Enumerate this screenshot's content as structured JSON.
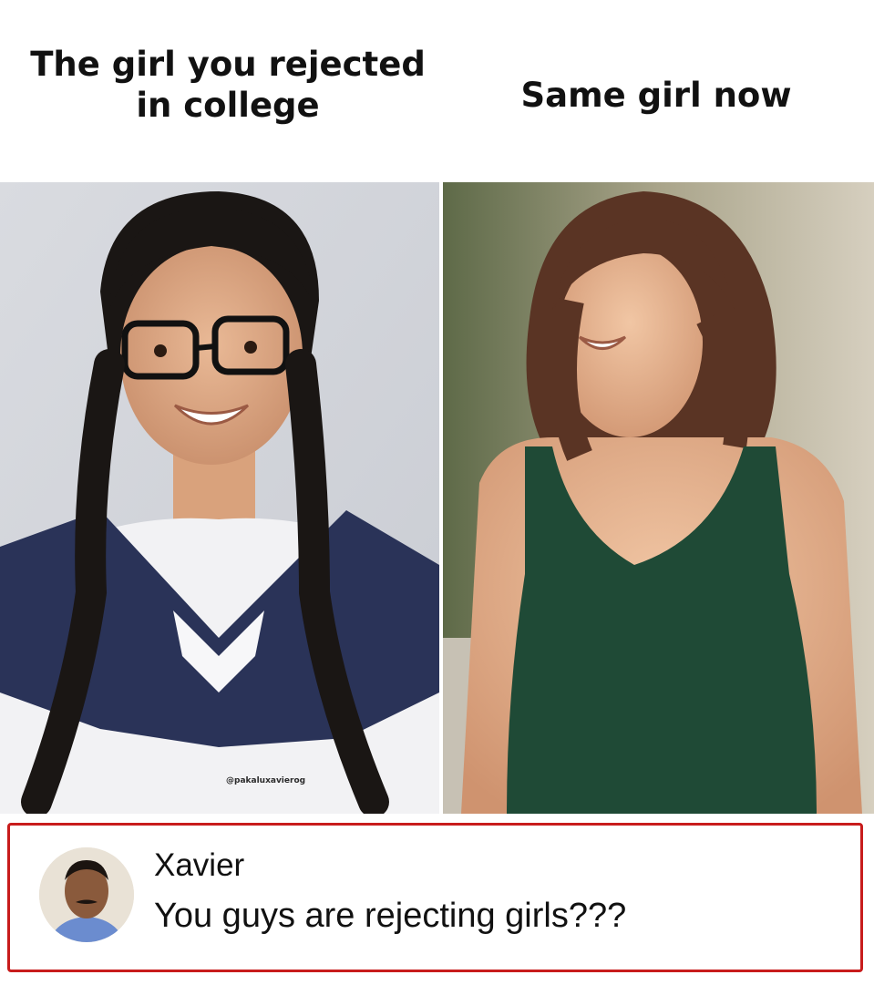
{
  "captions": {
    "left": "The girl you rejected in college",
    "right": "Same girl now"
  },
  "watermark": "@pakaluxavierog",
  "comment": {
    "author": "Xavier",
    "text": "You guys are rejecting girls???"
  },
  "colors": {
    "border": "#c81c1c",
    "uniform": "#2a3358",
    "tank_top": "#1f4a36"
  }
}
